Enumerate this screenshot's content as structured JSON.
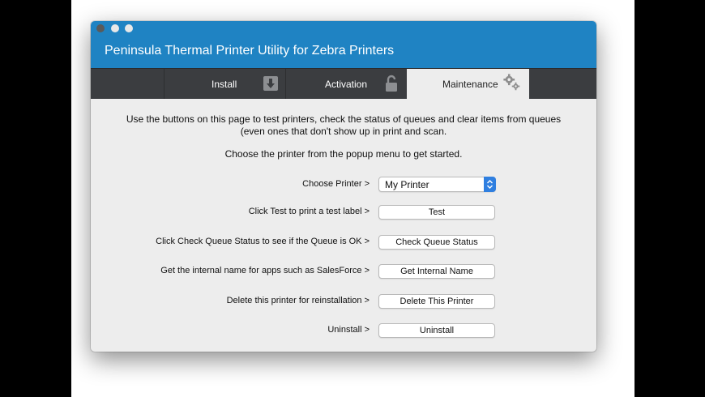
{
  "window": {
    "title": "Peninsula Thermal Printer Utility for Zebra Printers",
    "accent_color": "#1f83c3"
  },
  "tabs": [
    {
      "label": "Install",
      "icon": "download-icon",
      "active": false
    },
    {
      "label": "Activation",
      "icon": "unlock-icon",
      "active": false
    },
    {
      "label": "Maintenance",
      "icon": "gear-icon",
      "active": true
    }
  ],
  "maintenance": {
    "intro": "Use the buttons on this page to test printers, check the status of queues and clear items from queues (even ones that don't show up in print and scan.",
    "instruction": "Choose the printer from the popup menu to get started.",
    "choose_printer": {
      "label": "Choose Printer >",
      "selected": "My Printer"
    },
    "rows": [
      {
        "label": "Click Test to print a test label >",
        "button": "Test"
      },
      {
        "label": "Click Check Queue Status to see if the Queue is OK >",
        "button": "Check Queue Status"
      },
      {
        "label": "Get the internal name for apps such as SalesForce >",
        "button": "Get Internal Name"
      },
      {
        "label": "Delete this printer for reinstallation >",
        "button": "Delete This Printer"
      },
      {
        "label": "Uninstall >",
        "button": "Uninstall"
      }
    ]
  }
}
